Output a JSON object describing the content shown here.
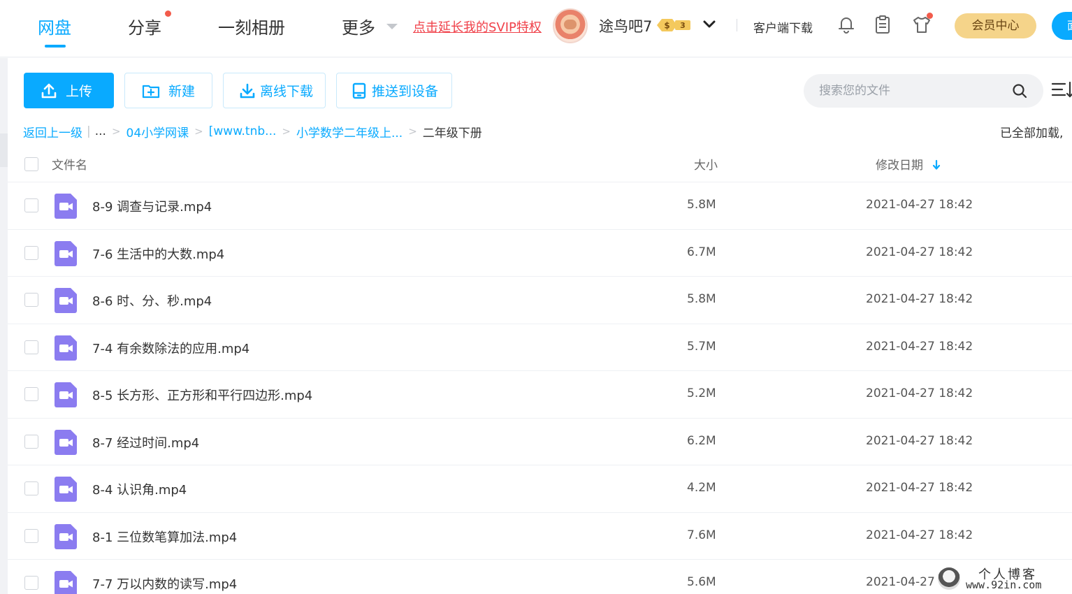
{
  "nav": {
    "tabs": [
      {
        "label": "网盘"
      },
      {
        "label": "分享"
      },
      {
        "label": "一刻相册"
      },
      {
        "label": "更多"
      }
    ],
    "svip_link": "点击延长我的SVIP特权",
    "username": "途鸟吧7",
    "vip_level": "3",
    "client_download": "客户端下载",
    "member_center": "会员中心",
    "blue_pill_label": "面"
  },
  "toolbar": {
    "upload": "上传",
    "new_folder": "新建",
    "offline_download": "离线下载",
    "push_to_device": "推送到设备",
    "search_placeholder": "搜索您的文件"
  },
  "breadcrumb": {
    "back": "返回上一级",
    "ellipsis": "...",
    "items": [
      "04小学网课",
      "[www.tnb...",
      "小学数学二年级上..."
    ],
    "current": "二年级下册",
    "loaded_note": "已全部加载,"
  },
  "table": {
    "columns": {
      "name": "文件名",
      "size": "大小",
      "modified": "修改日期"
    },
    "rows": [
      {
        "name": "8-9 调查与记录.mp4",
        "size": "5.8M",
        "date": "2021-04-27 18:42"
      },
      {
        "name": "7-6 生活中的大数.mp4",
        "size": "6.7M",
        "date": "2021-04-27 18:42"
      },
      {
        "name": "8-6 时、分、秒.mp4",
        "size": "5.8M",
        "date": "2021-04-27 18:42"
      },
      {
        "name": "7-4 有余数除法的应用.mp4",
        "size": "5.7M",
        "date": "2021-04-27 18:42"
      },
      {
        "name": "8-5 长方形、正方形和平行四边形.mp4",
        "size": "5.2M",
        "date": "2021-04-27 18:42"
      },
      {
        "name": "8-7 经过时间.mp4",
        "size": "6.2M",
        "date": "2021-04-27 18:42"
      },
      {
        "name": "8-4 认识角.mp4",
        "size": "4.2M",
        "date": "2021-04-27 18:42"
      },
      {
        "name": "8-1 三位数笔算加法.mp4",
        "size": "7.6M",
        "date": "2021-04-27 18:42"
      },
      {
        "name": "7-7 万以内数的读写.mp4",
        "size": "5.6M",
        "date": "2021-04-27"
      }
    ]
  },
  "watermark": {
    "title": "个人博客",
    "url": "www.92in.com"
  },
  "colors": {
    "accent": "#09aaff",
    "svip_red": "#f0414a",
    "video_icon": "#8b7cf0",
    "member_gold": "#f5d48a"
  }
}
